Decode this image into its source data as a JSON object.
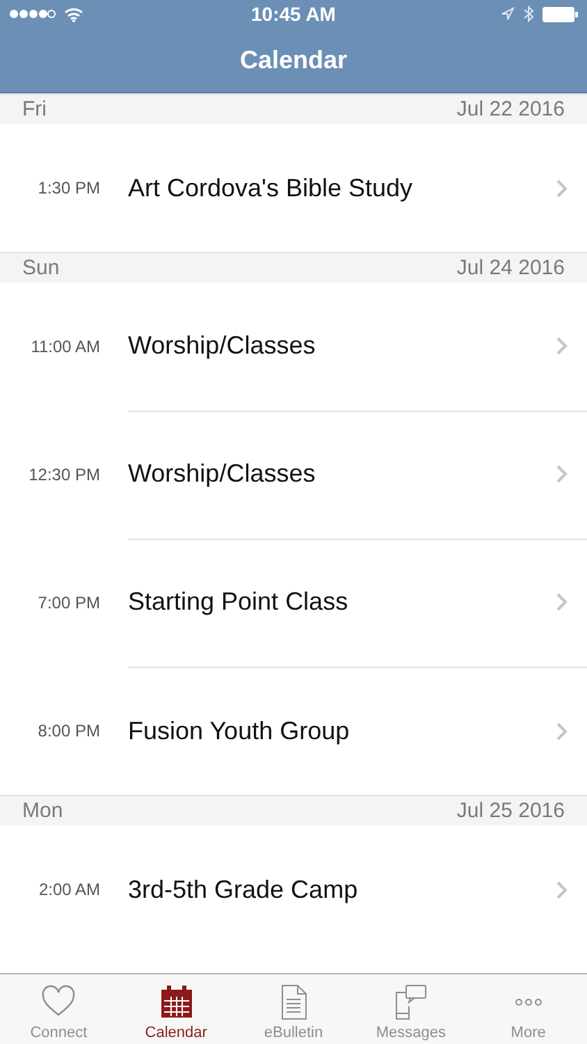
{
  "status_bar": {
    "time": "10:45 AM"
  },
  "nav_bar": {
    "title": "Calendar"
  },
  "days": [
    {
      "weekday": "Fri",
      "date": "Jul 22 2016",
      "events": [
        {
          "time": "1:30 PM",
          "title": "Art Cordova's Bible Study"
        }
      ]
    },
    {
      "weekday": "Sun",
      "date": "Jul 24 2016",
      "events": [
        {
          "time": "11:00 AM",
          "title": "Worship/Classes"
        },
        {
          "time": "12:30 PM",
          "title": "Worship/Classes"
        },
        {
          "time": "7:00 PM",
          "title": "Starting Point Class"
        },
        {
          "time": "8:00 PM",
          "title": "Fusion Youth Group"
        }
      ]
    },
    {
      "weekday": "Mon",
      "date": "Jul 25 2016",
      "events": [
        {
          "time": "2:00 AM",
          "title": "3rd-5th Grade Camp"
        }
      ]
    }
  ],
  "tab_bar": [
    {
      "kind": "heart",
      "label": "Connect",
      "selected": false
    },
    {
      "kind": "calendar",
      "label": "Calendar",
      "selected": true
    },
    {
      "kind": "document",
      "label": "eBulletin",
      "selected": false
    },
    {
      "kind": "messages",
      "label": "Messages",
      "selected": false
    },
    {
      "kind": "more",
      "label": "More",
      "selected": false
    }
  ]
}
